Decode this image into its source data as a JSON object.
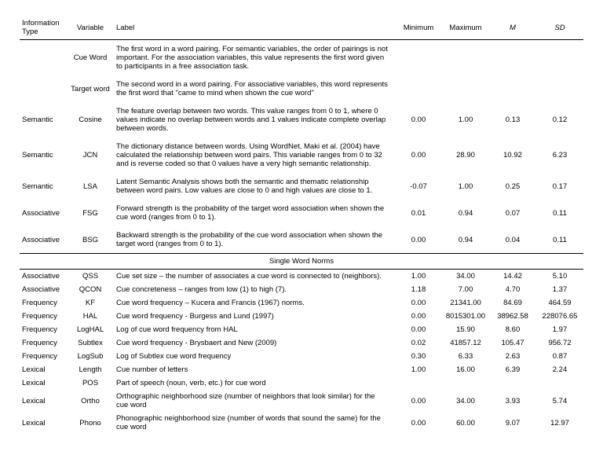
{
  "headers": {
    "type": "Information Type",
    "variable": "Variable",
    "label": "Label",
    "min": "Minimum",
    "max": "Maximum",
    "m": "M",
    "sd": "SD"
  },
  "section_title": "Single Word Norms",
  "pair_rows": [
    {
      "type": "",
      "variable": "Cue Word",
      "label": "The first word in a word pairing.  For semantic variables, the order of pairings is not important.  For the association variables, this value represents the first word given to participants in a free association task.",
      "min": "",
      "max": "",
      "m": "",
      "sd": ""
    },
    {
      "type": "",
      "variable": "Target word",
      "label": "The second word in a word pairing.  For associative variables, this word represents the first word that \"came to mind when shown the cue word\"",
      "min": "",
      "max": "",
      "m": "",
      "sd": ""
    },
    {
      "type": "Semantic",
      "variable": "Cosine",
      "label": "The feature overlap between two words.  This value ranges from 0 to 1, where 0 values indicate no overlap between words and 1 values indicate complete overlap between words.",
      "min": "0.00",
      "max": "1.00",
      "m": "0.13",
      "sd": "0.12"
    },
    {
      "type": "Semantic",
      "variable": "JCN",
      "label": "The dictionary distance between words.  Using WordNet, Maki et al. (2004) have calculated the relationship between word pairs.  This variable ranges from 0 to 32 and is reverse coded so that 0 values have a very high semantic relationship.",
      "min": "0.00",
      "max": "28.90",
      "m": "10.92",
      "sd": "6.23"
    },
    {
      "type": "Semantic",
      "variable": "LSA",
      "label": "Latent Semantic Analysis shows both the semantic and thematic relationship between word pairs.  Low values are close to 0 and high values are close to 1.",
      "min": "-0.07",
      "max": "1.00",
      "m": "0.25",
      "sd": "0.17"
    },
    {
      "type": "Associative",
      "variable": "FSG",
      "label": "Forward strength is the probability of the target word association when shown the cue word (ranges from 0 to 1).",
      "min": "0.01",
      "max": "0.94",
      "m": "0.07",
      "sd": "0.11"
    },
    {
      "type": "Associative",
      "variable": "BSG",
      "label": "Backward strength is the probability of the cue word association when shown the target word (ranges from 0 to 1).",
      "min": "0.00",
      "max": "0.94",
      "m": "0.04",
      "sd": "0.11"
    }
  ],
  "norm_rows": [
    {
      "type": "Associative",
      "variable": "QSS",
      "label": "Cue set size – the number of associates a cue word is connected to (neighbors).",
      "min": "1.00",
      "max": "34.00",
      "m": "14.42",
      "sd": "5.10"
    },
    {
      "type": "Associative",
      "variable": "QCON",
      "label": "Cue concreteness – ranges from low (1) to high (7).",
      "min": "1.18",
      "max": "7.00",
      "m": "4.70",
      "sd": "1.37"
    },
    {
      "type": "Frequency",
      "variable": "KF",
      "label": "Cue word frequency – Kucera and Francis (1967) norms.",
      "min": "0.00",
      "max": "21341.00",
      "m": "84.69",
      "sd": "464.59"
    },
    {
      "type": "Frequency",
      "variable": "HAL",
      "label": "Cue word frequency - Burgess and Lund (1997)",
      "min": "0.00",
      "max": "8015301.00",
      "m": "38962.58",
      "sd": "228076.65"
    },
    {
      "type": "Frequency",
      "variable": "LogHAL",
      "label": "Log of cue word frequency from HAL",
      "min": "0.00",
      "max": "15.90",
      "m": "8.60",
      "sd": "1.97"
    },
    {
      "type": "Frequency",
      "variable": "Subtlex",
      "label": "Cue word frequency - Brysbaert and New (2009)",
      "min": "0.02",
      "max": "41857.12",
      "m": "105.47",
      "sd": "956.72"
    },
    {
      "type": "Frequency",
      "variable": "LogSub",
      "label": "Log of Subtlex cue word frequency",
      "min": "0.30",
      "max": "6.33",
      "m": "2.63",
      "sd": "0.87"
    },
    {
      "type": "Lexical",
      "variable": "Length",
      "label": "Cue number of letters",
      "min": "1.00",
      "max": "16.00",
      "m": "6.39",
      "sd": "2.24"
    },
    {
      "type": "Lexical",
      "variable": "POS",
      "label": "Part of speech (noun, verb, etc.) for cue word",
      "min": "",
      "max": "",
      "m": "",
      "sd": ""
    },
    {
      "type": "Lexical",
      "variable": "Ortho",
      "label": "Orthographic neighborhood size (number of neighbors that look similar) for the cue word",
      "min": "0.00",
      "max": "34.00",
      "m": "3.93",
      "sd": "5.74"
    },
    {
      "type": "Lexical",
      "variable": "Phono",
      "label": "Phonographic neighborhood size (number of words that sound the same) for the cue word",
      "min": "0.00",
      "max": "60.00",
      "m": "9.07",
      "sd": "12.97"
    }
  ]
}
